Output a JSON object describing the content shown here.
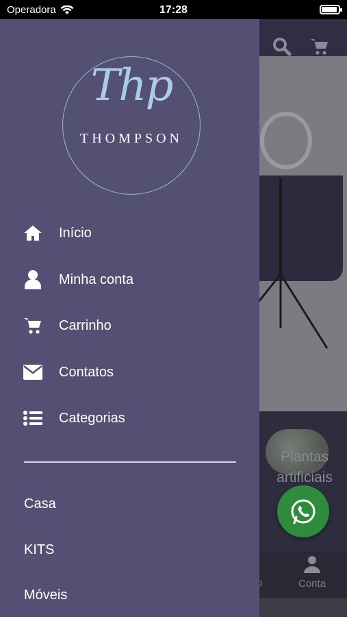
{
  "status": {
    "carrier": "Operadora",
    "time": "17:28",
    "battery_level": 0.9
  },
  "logo": {
    "script": "Thp",
    "wordmark": "THOMPSON"
  },
  "menu": {
    "items": [
      {
        "label": "Início",
        "icon": "home-icon"
      },
      {
        "label": "Minha conta",
        "icon": "user-icon"
      },
      {
        "label": "Carrinho",
        "icon": "cart-icon"
      },
      {
        "label": "Contatos",
        "icon": "envelope-icon"
      },
      {
        "label": "Categorias",
        "icon": "list-icon"
      }
    ]
  },
  "categories": [
    "Casa",
    "KITS",
    "Móveis"
  ],
  "background": {
    "category_card": "Plantas artificiais",
    "nav_partial": "o",
    "nav_account": "Conta"
  },
  "colors": {
    "drawer": "#545074",
    "header": "#312d42",
    "whatsapp": "#2e8c3a",
    "logo_accent": "#a9cde6"
  }
}
